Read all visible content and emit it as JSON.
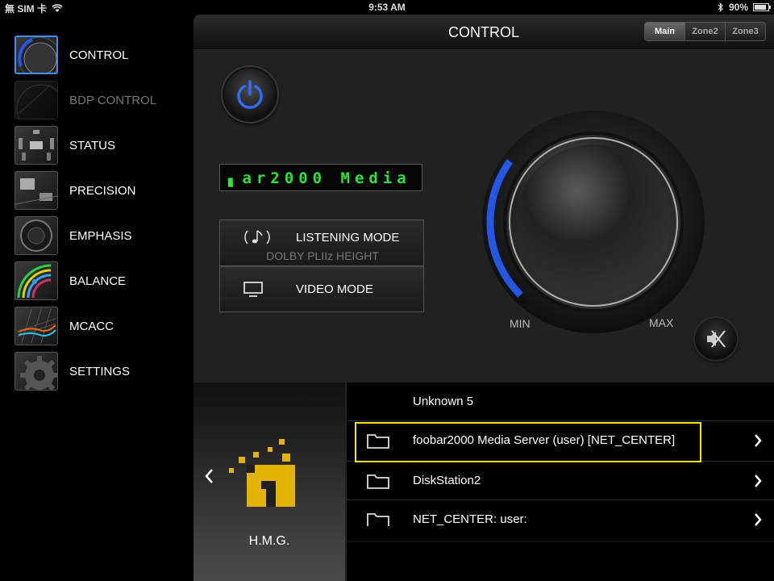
{
  "status_bar": {
    "carrier": "無 SIM 卡",
    "time": "9:53 AM",
    "battery": "90%",
    "battery_level": 0.9
  },
  "sidebar": {
    "items": [
      {
        "label": "CONTROL",
        "icon": "knob-thumbnail",
        "active": true
      },
      {
        "label": "BDP CONTROL",
        "icon": "disc-thumbnail",
        "disabled": true
      },
      {
        "label": "STATUS",
        "icon": "speakers-thumbnail"
      },
      {
        "label": "PRECISION",
        "icon": "room-thumbnail"
      },
      {
        "label": "EMPHASIS",
        "icon": "speaker-cone-thumbnail"
      },
      {
        "label": "BALANCE",
        "icon": "balance-meter-thumbnail"
      },
      {
        "label": "MCACC",
        "icon": "eq-grid-thumbnail"
      },
      {
        "label": "SETTINGS",
        "icon": "gear-thumbnail"
      }
    ]
  },
  "header": {
    "title": "CONTROL",
    "zones": [
      {
        "label": "Main",
        "active": true
      },
      {
        "label": "Zone2"
      },
      {
        "label": "Zone3"
      }
    ]
  },
  "control": {
    "display_text": "▖ar2000 Media",
    "listening_mode_label": "LISTENING MODE",
    "listening_mode_value": "DOLBY PLIIz HEIGHT",
    "video_mode_label": "VIDEO MODE",
    "volume_min": "MIN",
    "volume_max": "MAX",
    "volume_level": 0.3,
    "accent_color": "#2457e6",
    "display_color": "#29e43a"
  },
  "source": {
    "name": "H.M.G.",
    "logo_color": "#e2b300"
  },
  "browse_list": {
    "items": [
      {
        "label": "Unknown 5",
        "folder": false,
        "chevron": false
      },
      {
        "label": "foobar2000 Media Server (user) [NET_CENTER]",
        "folder": true,
        "chevron": true,
        "highlight": true
      },
      {
        "label": "DiskStation2",
        "folder": true,
        "chevron": true
      },
      {
        "label": "NET_CENTER: user:",
        "folder": true,
        "chevron": true
      }
    ],
    "highlight_color": "#f2e421"
  }
}
